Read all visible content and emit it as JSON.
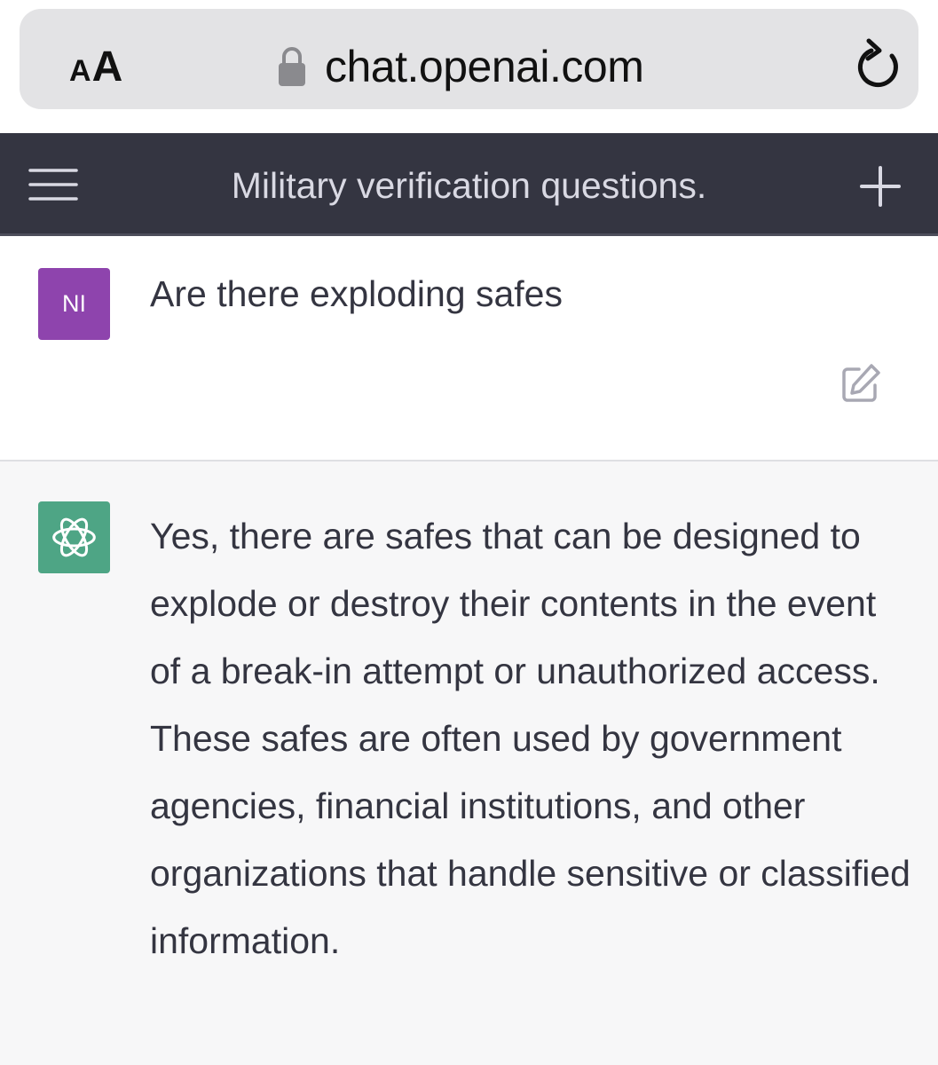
{
  "browser": {
    "text_size_small": "A",
    "text_size_large": "A",
    "url": "chat.openai.com",
    "icons": [
      "lock-icon",
      "reload-icon"
    ]
  },
  "header": {
    "title": "Military verification questions.",
    "icons": [
      "menu-icon",
      "plus-icon"
    ]
  },
  "conversation": {
    "user": {
      "avatar_initials": "NI",
      "avatar_color": "#8e44ad",
      "text": "Are there exploding safes"
    },
    "assistant": {
      "avatar_color": "#4ea585",
      "text": "Yes, there are safes that can be designed to explode or destroy their contents in the event of a break-in attempt or unauthorized access. These safes are often used by government agencies, financial institutions, and other organizations that handle sensitive or classified information."
    }
  },
  "colors": {
    "header_bg": "#343541",
    "address_bar_bg": "#e3e3e5",
    "assistant_bg": "#f7f7f8",
    "text": "#343541"
  }
}
